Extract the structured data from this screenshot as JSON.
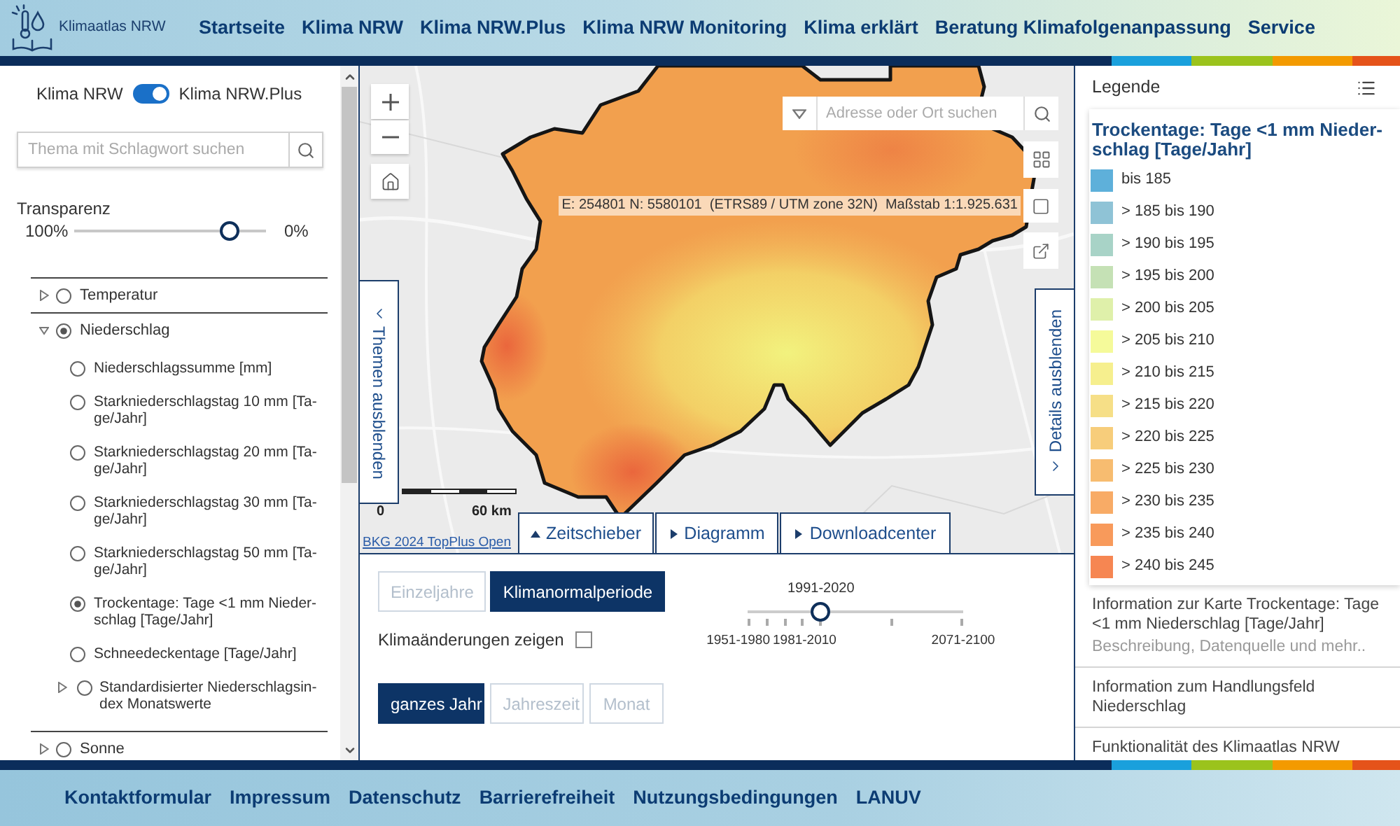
{
  "header": {
    "logo_text": "Klimaatlas NRW",
    "nav": [
      "Startseite",
      "Klima NRW",
      "Klima NRW.Plus",
      "Klima NRW Monitoring",
      "Klima erklärt",
      "Beratung Klimafolgenanpassung",
      "Service"
    ]
  },
  "sidebar": {
    "mode_toggle": {
      "left_label": "Klima NRW",
      "right_label": "Klima NRW.Plus",
      "on": true
    },
    "search": {
      "placeholder": "Thema mit Schlagwort suchen"
    },
    "transparency": {
      "label": "Transparenz",
      "min_label": "100%",
      "max_label": "0%",
      "level": 0.81
    },
    "topics": [
      {
        "label": "Temperatur",
        "expanded": false,
        "selected": false
      },
      {
        "label": "Niederschlag",
        "expanded": true,
        "selected": true,
        "children": [
          {
            "label": "Niederschlagssumme [mm]",
            "selected": false
          },
          {
            "label": "Starkniederschlagstag 10 mm [Ta-\nge/Jahr]",
            "selected": false
          },
          {
            "label": "Starkniederschlagstag 20 mm [Ta-\nge/Jahr]",
            "selected": false
          },
          {
            "label": "Starkniederschlagstag 30 mm [Ta-\nge/Jahr]",
            "selected": false
          },
          {
            "label": "Starkniederschlagstag 50 mm [Ta-\nge/Jahr]",
            "selected": false
          },
          {
            "label": "Trockentage: Tage <1 mm Nieder-\nschlag [Tage/Jahr]",
            "selected": true
          },
          {
            "label": "Schneedeckentage [Tage/Jahr]",
            "selected": false
          },
          {
            "label": "Standardisierter Niederschlagsin-\ndex Monatswerte",
            "selected": false,
            "expanded": false
          }
        ]
      },
      {
        "label": "Sonne",
        "expanded": false,
        "selected": false
      }
    ]
  },
  "map": {
    "search": {
      "placeholder": "Adresse oder Ort suchen"
    },
    "coordinate_readout": "E: 254801 N: 5580101  (ETRS89 / UTM zone 32N)  Maßstab 1:1.925.631",
    "scale_bar": {
      "start_label": "0",
      "end_label": "60 km"
    },
    "attribution": "BKG 2024 TopPlus Open",
    "hide_topics_button": "Themen ausblenden",
    "hide_details_button": "Details ausblenden",
    "tabs": [
      {
        "label": "Zeitschieber",
        "expanded": true
      },
      {
        "label": "Diagramm",
        "expanded": false
      },
      {
        "label": "Downloadcenter",
        "expanded": false
      }
    ]
  },
  "time_panel": {
    "mode_buttons": [
      {
        "label": "Einzeljahre",
        "selected": false
      },
      {
        "label": "Klimanormalperiode",
        "selected": true
      }
    ],
    "climate_change_checkbox": {
      "label": "Klimaänderungen zeigen",
      "checked": false
    },
    "period_slider": {
      "value_label": "1991-2020",
      "level": 0.34,
      "tick_labels": [
        "1951-1980",
        "1981-2010",
        "2071-2100"
      ]
    },
    "season_buttons": [
      {
        "label": "ganzes Jahr",
        "selected": true
      },
      {
        "label": "Jahreszeit",
        "selected": false
      },
      {
        "label": "Monat",
        "selected": false
      }
    ]
  },
  "legend": {
    "heading": "Legende",
    "title": "Trockentage: Tage <1 mm Nieder-\nschlag [Tage/Jahr]",
    "items": [
      {
        "label": "bis 185",
        "color": "#5eb0da"
      },
      {
        "label": "> 185 bis 190",
        "color": "#8fc3d6"
      },
      {
        "label": "> 190 bis 195",
        "color": "#a8d3c7"
      },
      {
        "label": "> 195 bis 200",
        "color": "#c5e1b5"
      },
      {
        "label": "> 200 bis 205",
        "color": "#dff0aa"
      },
      {
        "label": "> 205 bis 210",
        "color": "#f5fa9a"
      },
      {
        "label": "> 210 bis 215",
        "color": "#f6ef8e"
      },
      {
        "label": "> 215 bis 220",
        "color": "#f6df87"
      },
      {
        "label": "> 220 bis 225",
        "color": "#f7cd7b"
      },
      {
        "label": "> 225 bis 230",
        "color": "#f7bc70"
      },
      {
        "label": "> 230 bis 235",
        "color": "#f8ab66"
      },
      {
        "label": "> 235 bis 240",
        "color": "#f89a5b"
      },
      {
        "label": "> 240 bis 245",
        "color": "#f68652"
      }
    ]
  },
  "info_sections": [
    {
      "title": "Information zur Karte Trockentage: Tage <1 mm Niederschlag [Tage/Jahr]",
      "subtitle": "Beschreibung, Datenquelle und mehr.."
    },
    {
      "title": "Information zum Handlungsfeld Niederschlag"
    },
    {
      "title": "Funktionalität des Klimaatlas NRW"
    }
  ],
  "footer": {
    "links": [
      "Kontaktformular",
      "Impressum",
      "Datenschutz",
      "Barrierefreiheit",
      "Nutzungsbedingungen",
      "LANUV"
    ]
  }
}
